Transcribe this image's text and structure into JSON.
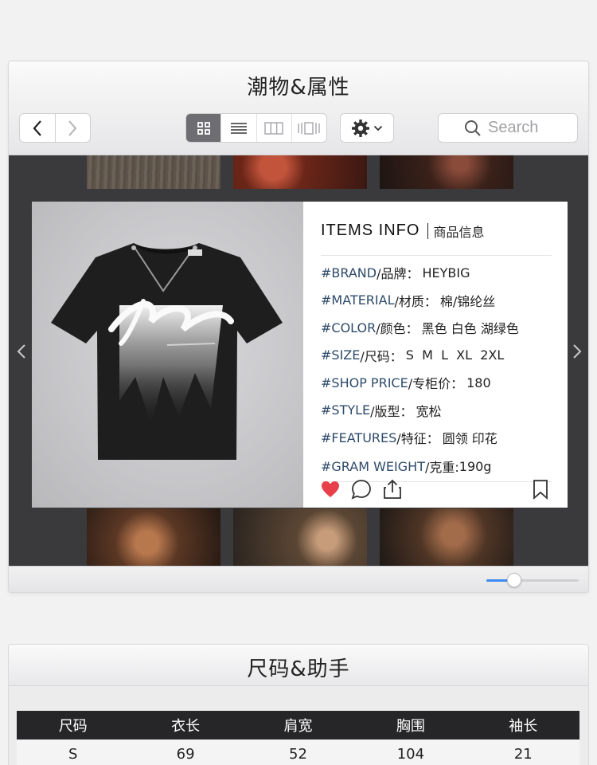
{
  "window1": {
    "title": "潮物&属性",
    "toolbar": {
      "back_icon": "chevron-left-icon",
      "forward_icon": "chevron-right-icon",
      "views": [
        "grid-view-icon",
        "list-view-icon",
        "column-view-icon",
        "coverflow-view-icon"
      ],
      "active_view": 0,
      "settings_icon": "gear-icon",
      "search_placeholder": "Search"
    },
    "card": {
      "info_title": "ITEMS INFO",
      "info_subtitle": "商品信息",
      "rows": [
        {
          "tag": "#BRAND",
          "label": "/品牌：",
          "value": "HEYBIG"
        },
        {
          "tag": "#MATERIAL",
          "label": "/材质：",
          "value": "棉/锦纶丝"
        },
        {
          "tag": "#COLOR",
          "label": "/颜色：",
          "value": "黑色 白色 湖绿色"
        },
        {
          "tag": "#SIZE",
          "label": "/尺码：",
          "value": "S  M  L  XL  2XL"
        },
        {
          "tag": "#SHOP PRICE",
          "label": "/专柜价：",
          "value": "180"
        },
        {
          "tag": "#STYLE",
          "label": "/版型：",
          "value": "宽松"
        },
        {
          "tag": "#FEATURES",
          "label": "/特征：",
          "value": "圆领 印花"
        },
        {
          "tag": "#GRAM WEIGHT",
          "label": "/克重: ",
          "value": "190g"
        }
      ],
      "actions": [
        "heart-icon",
        "comment-icon",
        "share-icon",
        "bookmark-icon"
      ]
    },
    "slider_value": 0.3,
    "accent_color": "#3d8cf0",
    "like_color": "#e8404a"
  },
  "window2": {
    "title": "尺码&助手",
    "table": {
      "headers": [
        "尺码",
        "衣长",
        "肩宽",
        "胸围",
        "袖长"
      ],
      "rows": [
        [
          "S",
          "69",
          "52",
          "104",
          "21"
        ]
      ]
    }
  }
}
